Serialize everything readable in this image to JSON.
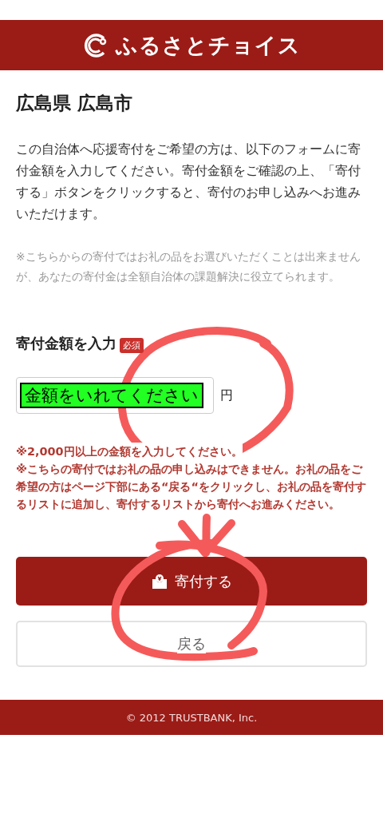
{
  "header": {
    "logo_text": "ふるさとチョイス"
  },
  "title": "広島県 広島市",
  "intro": "この自治体へ応援寄付をご希望の方は、以下のフォームに寄付金額を入力してください。寄付金額をご確認の上、「寄付する」ボタンをクリックすると、寄付のお申し込みへお進みいただけます。",
  "note": "※こちらからの寄付ではお礼の品をお選びいただくことは出来ませんが、あなたの寄付金は全額自治体の課題解決に役立てられます。",
  "amount_section": {
    "heading": "寄付金額を入力",
    "badge": "必須",
    "field_label": "金額をいれてください",
    "unit": "円",
    "warnings": [
      "※2,000円以上の金額を入力してください。",
      "※こちらの寄付ではお礼の品の申し込みはできません。お礼の品をご希望の方はページ下部にある“戻る“をクリックし、お礼の品を寄付するリストに追加し、寄付するリストから寄付へお進みください。"
    ]
  },
  "buttons": [
    {
      "kind": "primary",
      "label": "寄付する"
    },
    {
      "kind": "secondary",
      "label": "戻る"
    }
  ],
  "footer": "© 2012 TRUSTBANK, Inc."
}
